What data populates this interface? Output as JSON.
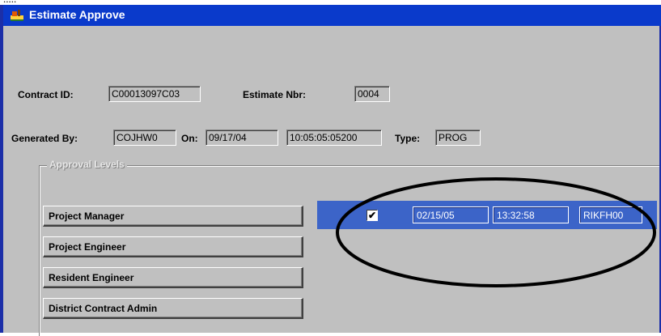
{
  "window": {
    "title": "Estimate Approve"
  },
  "header": {
    "contract_id_label": "Contract ID:",
    "contract_id": "C00013097C03",
    "estimate_nbr_label": "Estimate Nbr:",
    "estimate_nbr": "0004",
    "generated_by_label": "Generated By:",
    "generated_by": "COJHW0",
    "on_label": "On:",
    "on_date": "09/17/04",
    "on_time": "10:05:05:05200",
    "type_label": "Type:",
    "type": "PROG"
  },
  "approval": {
    "group_title": "Approval Levels",
    "levels": [
      {
        "label": "Project Manager"
      },
      {
        "label": "Project Engineer"
      },
      {
        "label": "Resident Engineer"
      },
      {
        "label": "District Contract Admin"
      }
    ],
    "selected": {
      "checked": "✔",
      "date": "02/15/05",
      "time": "13:32:58",
      "user": "RIKFH00"
    }
  },
  "colors": {
    "titlebar": "#0a3acb",
    "selection": "#3c64c8",
    "dialog": "#c0c0c0"
  }
}
